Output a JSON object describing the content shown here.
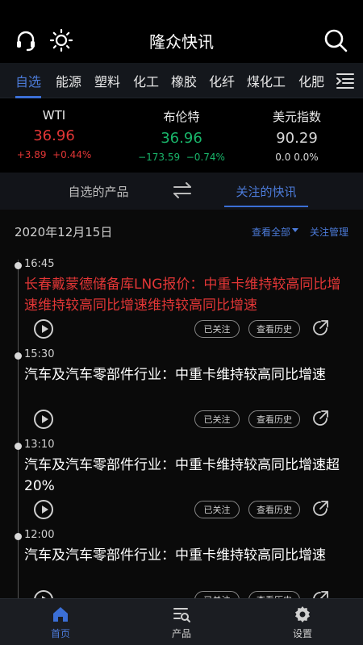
{
  "header": {
    "title": "隆众快讯",
    "left_icons": [
      "headset-icon",
      "sun-icon"
    ],
    "right_icon": "search-icon"
  },
  "category_tabs": [
    {
      "label": "自选",
      "active": true
    },
    {
      "label": "能源",
      "active": false
    },
    {
      "label": "塑料",
      "active": false
    },
    {
      "label": "化工",
      "active": false
    },
    {
      "label": "橡胶",
      "active": false
    },
    {
      "label": "化纤",
      "active": false
    },
    {
      "label": "煤化工",
      "active": false
    },
    {
      "label": "化肥",
      "active": false
    }
  ],
  "indices": [
    {
      "name": "WTI",
      "value": "36.96",
      "change": "+3.89",
      "change_pct": "+0.44%",
      "trend": "up"
    },
    {
      "name": "布伦特",
      "value": "36.96",
      "change": "−173.59",
      "change_pct": "−0.74%",
      "trend": "down"
    },
    {
      "name": "美元指数",
      "value": "90.29",
      "change": "0.0",
      "change_pct": "0.0%",
      "trend": "flat"
    }
  ],
  "toggle": {
    "left_label": "自选的产品",
    "right_label": "关注的快讯",
    "active": "right"
  },
  "date_row": {
    "date": "2020年12月15日",
    "view_all": "查看全部",
    "manage": "关注管理"
  },
  "news": [
    {
      "time": "16:45",
      "text": "长春戴蒙德储备库LNG报价：中重卡维持较高同比增速维持较高同比增速维持较高同比增速",
      "highlight": true,
      "follow_label": "已关注",
      "history_label": "查看历史"
    },
    {
      "time": "15:30",
      "text": "汽车及汽车零部件行业：中重卡维持较高同比增速",
      "highlight": false,
      "follow_label": "已关注",
      "history_label": "查看历史"
    },
    {
      "time": "13:10",
      "text": "汽车及汽车零部件行业：中重卡维持较高同比增速超20%",
      "highlight": false,
      "follow_label": "已关注",
      "history_label": "查看历史"
    },
    {
      "time": "12:00",
      "text": "汽车及汽车零部件行业：中重卡维持较高同比增速",
      "highlight": false,
      "follow_label": "已关注",
      "history_label": "查看历史"
    }
  ],
  "bottom_nav": [
    {
      "label": "首页",
      "icon": "home-icon",
      "active": true
    },
    {
      "label": "产品",
      "icon": "product-list-icon",
      "active": false
    },
    {
      "label": "设置",
      "icon": "gear-icon",
      "active": false
    }
  ],
  "colors": {
    "accent": "#3b6fd6",
    "up": "#e23636",
    "down": "#19b56a",
    "background": "#000000"
  }
}
